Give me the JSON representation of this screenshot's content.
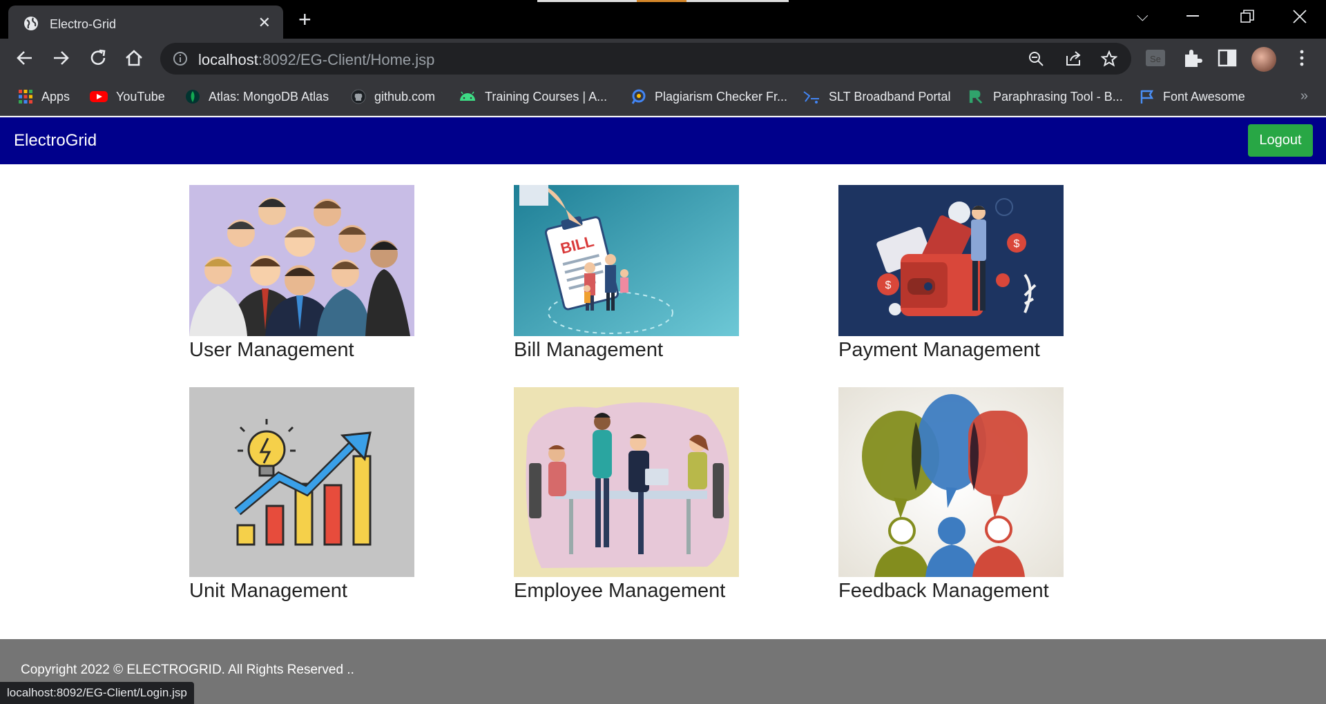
{
  "browser": {
    "tab_title": "Electro-Grid",
    "url_host": "localhost",
    "url_rest": ":8092/EG-Client/Home.jsp",
    "status_url": "localhost:8092/EG-Client/Login.jsp",
    "bookmarks": [
      {
        "label": "Apps",
        "icon": "apps-grid-icon"
      },
      {
        "label": "YouTube",
        "icon": "youtube-icon"
      },
      {
        "label": "Atlas: MongoDB Atlas",
        "icon": "mongodb-leaf-icon"
      },
      {
        "label": "github.com",
        "icon": "github-icon"
      },
      {
        "label": "Training Courses | A...",
        "icon": "android-icon"
      },
      {
        "label": "Plagiarism Checker Fr...",
        "icon": "plagiarism-checker-icon"
      },
      {
        "label": "SLT Broadband Portal",
        "icon": "slt-icon"
      },
      {
        "label": "Paraphrasing Tool - B...",
        "icon": "paraphrasing-tool-icon"
      },
      {
        "label": "Font Awesome",
        "icon": "font-awesome-flag-icon"
      }
    ]
  },
  "navbar": {
    "brand": "ElectroGrid",
    "logout_label": "Logout"
  },
  "cards": [
    {
      "title": "User Management",
      "image": "group-of-people-illustration"
    },
    {
      "title": "Bill Management",
      "image": "bill-clipboard-illustration"
    },
    {
      "title": "Payment Management",
      "image": "wallet-payment-illustration"
    },
    {
      "title": "Unit Management",
      "image": "energy-growth-chart-illustration"
    },
    {
      "title": "Employee Management",
      "image": "office-meeting-illustration"
    },
    {
      "title": "Feedback Management",
      "image": "speech-bubbles-illustration"
    }
  ],
  "footer": {
    "text": "Copyright 2022 © ELECTROGRID. All Rights Reserved .."
  },
  "colors": {
    "navbar_bg": "#00008b",
    "logout_bg": "#28a745",
    "footer_bg": "#757575"
  }
}
